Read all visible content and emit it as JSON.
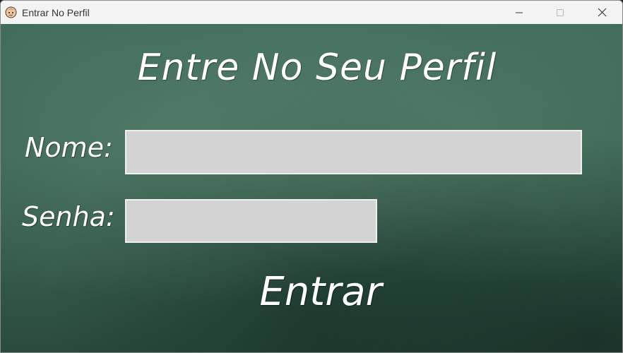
{
  "window": {
    "title": "Entrar No Perfil",
    "icon": "app-face-icon",
    "controls": [
      "minimize-icon",
      "maximize-icon",
      "close-icon"
    ]
  },
  "login": {
    "heading": "Entre No Seu Perfil",
    "name_label": "Nome:",
    "name_value": "",
    "password_label": "Senha:",
    "password_value": "",
    "submit_label": "Entrar"
  },
  "colors": {
    "board": "#3b6453",
    "chalk": "#ffffff",
    "field_fill": "#d3d3d3",
    "field_border": "#f0f0f0"
  }
}
